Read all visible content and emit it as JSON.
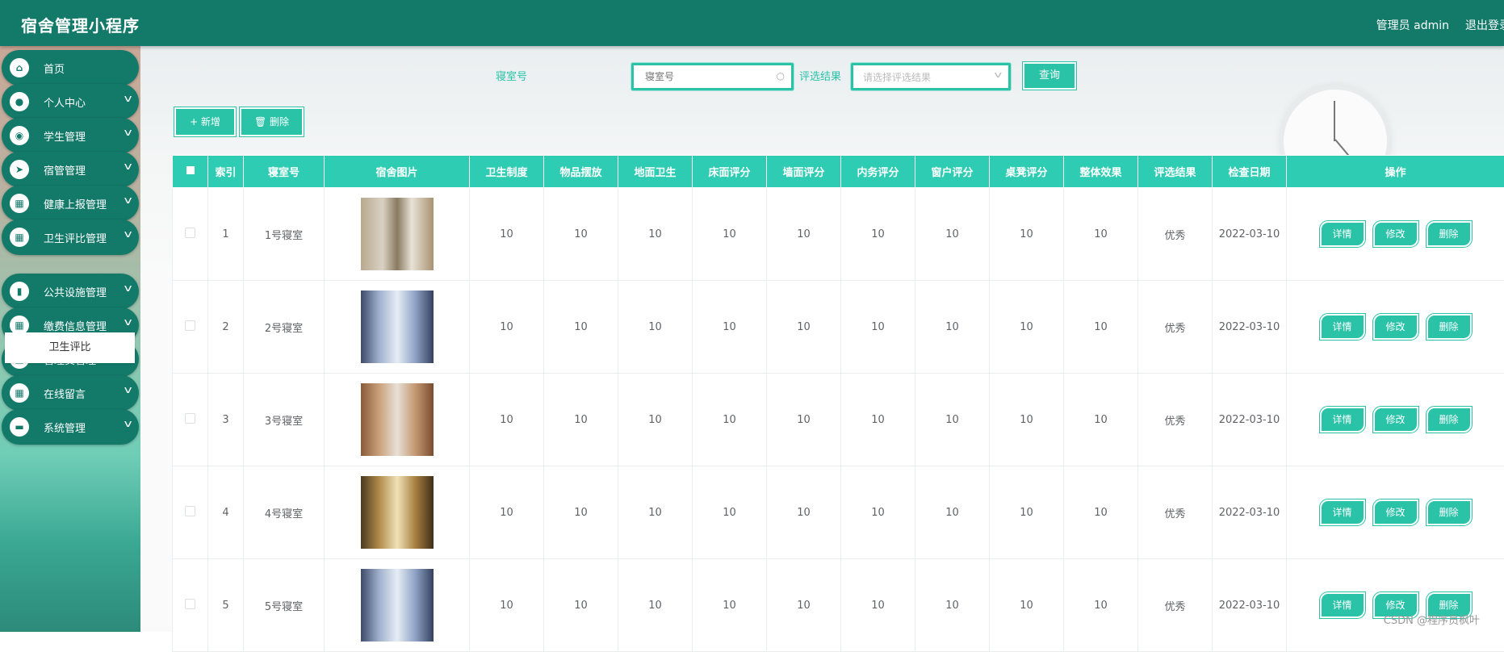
{
  "header": {
    "title": "宿舍管理小程序",
    "user": "管理员 admin",
    "logout": "退出登录"
  },
  "sidebar": {
    "items": [
      {
        "label": "首页",
        "icon": "home-icon",
        "glyph": "⌂",
        "chevron": false
      },
      {
        "label": "个人中心",
        "icon": "user-icon",
        "glyph": "●",
        "chevron": true
      },
      {
        "label": "学生管理",
        "icon": "location-icon",
        "glyph": "◉",
        "chevron": true
      },
      {
        "label": "宿管管理",
        "icon": "send-icon",
        "glyph": "➤",
        "chevron": true
      },
      {
        "label": "健康上报管理",
        "icon": "grid-icon",
        "glyph": "▦",
        "chevron": true
      },
      {
        "label": "卫生评比管理",
        "icon": "grid-icon",
        "glyph": "▦",
        "chevron": true
      },
      {
        "label": "公共设施管理",
        "icon": "book-icon",
        "glyph": "▮",
        "chevron": true
      },
      {
        "label": "缴费信息管理",
        "icon": "grid-icon",
        "glyph": "▦",
        "chevron": true
      },
      {
        "label": "管理员管理",
        "icon": "grid-icon",
        "glyph": "▦",
        "chevron": true
      },
      {
        "label": "在线留言",
        "icon": "grid-icon",
        "glyph": "▦",
        "chevron": true
      },
      {
        "label": "系统管理",
        "icon": "wallet-icon",
        "glyph": "▬",
        "chevron": true
      }
    ],
    "sub_item": "卫生评比"
  },
  "search": {
    "room_label": "寝室号",
    "room_placeholder": "寝室号",
    "result_label": "评选结果",
    "result_placeholder": "请选择评选结果",
    "query_button": "查询"
  },
  "toolbar": {
    "add": "+ 新增",
    "delete": "🗑 删除"
  },
  "table": {
    "headers": [
      "索引",
      "寝室号",
      "宿舍图片",
      "卫生制度",
      "物品摆放",
      "地面卫生",
      "床面评分",
      "墙面评分",
      "内务评分",
      "窗户评分",
      "桌凳评分",
      "整体效果",
      "评选结果",
      "检查日期",
      "操作"
    ],
    "rows": [
      {
        "index": "1",
        "room": "1号寝室",
        "scores": [
          "10",
          "10",
          "10",
          "10",
          "10",
          "10",
          "10",
          "10",
          "10"
        ],
        "result": "优秀",
        "date": "2022-03-10",
        "image": "img1"
      },
      {
        "index": "2",
        "room": "2号寝室",
        "scores": [
          "10",
          "10",
          "10",
          "10",
          "10",
          "10",
          "10",
          "10",
          "10"
        ],
        "result": "优秀",
        "date": "2022-03-10",
        "image": "img2"
      },
      {
        "index": "3",
        "room": "3号寝室",
        "scores": [
          "10",
          "10",
          "10",
          "10",
          "10",
          "10",
          "10",
          "10",
          "10"
        ],
        "result": "优秀",
        "date": "2022-03-10",
        "image": "img3"
      },
      {
        "index": "4",
        "room": "4号寝室",
        "scores": [
          "10",
          "10",
          "10",
          "10",
          "10",
          "10",
          "10",
          "10",
          "10"
        ],
        "result": "优秀",
        "date": "2022-03-10",
        "image": "img4"
      },
      {
        "index": "5",
        "room": "5号寝室",
        "scores": [
          "10",
          "10",
          "10",
          "10",
          "10",
          "10",
          "10",
          "10",
          "10"
        ],
        "result": "优秀",
        "date": "2022-03-10",
        "image": "img2"
      }
    ],
    "actions": [
      "详情",
      "修改",
      "删除"
    ]
  },
  "watermark": "CSDN @程序员枫叶",
  "colors": {
    "header": "#137a6a",
    "accent": "#2bc3a8",
    "table_header": "#2ecdb3"
  }
}
